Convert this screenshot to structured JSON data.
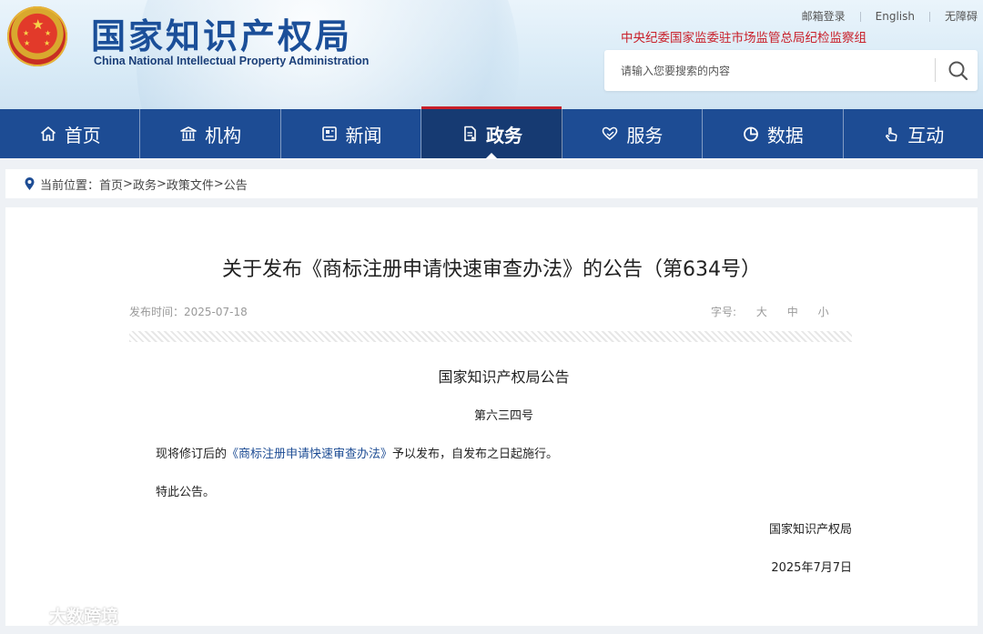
{
  "header": {
    "logo_cn": "国家知识产权局",
    "logo_en": "China National Intellectual Property Administration",
    "top_links": [
      "邮箱登录",
      "English",
      "无障碍"
    ],
    "discipline_text": "中央纪委国家监委驻市场监管总局纪检监察组",
    "search_placeholder": "请输入您要搜索的内容"
  },
  "nav": {
    "items": [
      {
        "label": "首页",
        "icon": "home-icon"
      },
      {
        "label": "机构",
        "icon": "building-icon"
      },
      {
        "label": "新闻",
        "icon": "newspaper-icon"
      },
      {
        "label": "政务",
        "icon": "document-icon"
      },
      {
        "label": "服务",
        "icon": "heart-hand-icon"
      },
      {
        "label": "数据",
        "icon": "pie-chart-icon"
      },
      {
        "label": "互动",
        "icon": "hand-pointer-icon"
      }
    ],
    "active": "政务"
  },
  "breadcrumb": {
    "prefix": "当前位置：",
    "items": [
      "首页",
      "政务",
      "政策文件",
      "公告"
    ],
    "separator": ">"
  },
  "article": {
    "title": "关于发布《商标注册申请快速审查办法》的公告（第634号）",
    "publish_label": "发布时间：",
    "publish_date": "2025-07-18",
    "font_size_label": "字号:",
    "font_sizes": [
      "大",
      "中",
      "小"
    ],
    "doc_heading": "国家知识产权局公告",
    "doc_number": "第六三四号",
    "body_prefix": "现将修订后的",
    "body_link": "《商标注册申请快速审查办法》",
    "body_suffix": "予以发布，自发布之日起施行。",
    "closing": "特此公告。",
    "signatory": "国家知识产权局",
    "sign_date": "2025年7月7日"
  },
  "watermark": "大数跨境",
  "colors": {
    "nav_bg": "#1d4c94",
    "nav_active_bg": "#163a72",
    "accent_red": "#c9202a",
    "logo_blue": "#1b4f99"
  }
}
